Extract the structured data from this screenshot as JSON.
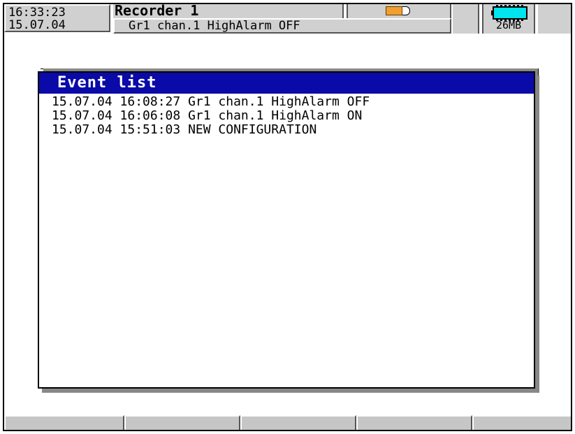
{
  "header": {
    "time": "16:33:23",
    "date": "15.07.04",
    "recorder_title": "Recorder  1",
    "status_message": "Gr1 chan.1 HighAlarm OFF",
    "memory": "26MB",
    "battery_icon": "battery-icon",
    "memory_card_icon": "memory-card-icon"
  },
  "event_list": {
    "title": "Event list",
    "events": [
      "15.07.04 16:08:27 Gr1 chan.1 HighAlarm OFF",
      "15.07.04 16:06:08 Gr1 chan.1 HighAlarm ON",
      "15.07.04 15:51:03 NEW CONFIGURATION"
    ]
  },
  "softkeys": [
    "",
    "",
    "",
    "",
    ""
  ],
  "colors": {
    "title_bar": "#0a0aa8",
    "panel_gray": "#c6c6c6",
    "battery": "#f0a030",
    "memory_card": "#00e5ee"
  }
}
